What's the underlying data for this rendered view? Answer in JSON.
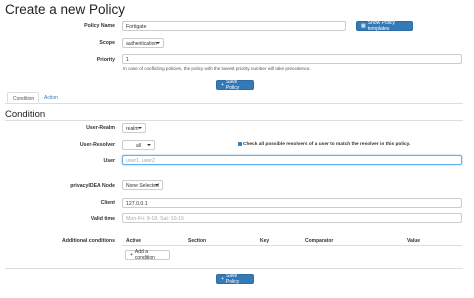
{
  "page": {
    "title": "Create a new Policy"
  },
  "form": {
    "policy_name": {
      "label": "Policy Name",
      "value": "Fortigate"
    },
    "show_templates": "Show Policy templates",
    "scope": {
      "label": "Scope",
      "value": "authentication"
    },
    "priority": {
      "label": "Priority",
      "value": "1",
      "help": "In case of conflicting policies, the policy with the lowest priority number will take precedence."
    },
    "save_top": "Save Policy",
    "save_bottom": "Save Policy"
  },
  "tabs": [
    {
      "label": "Condition"
    },
    {
      "label": "Action"
    }
  ],
  "condition": {
    "heading": "Condition",
    "user_realm": {
      "label": "User-Realm",
      "value": "realm"
    },
    "user_resolver": {
      "label": "User-Resolver",
      "value": "all",
      "check_label": "Check all possible resolvers of a user to match the resolver in this policy."
    },
    "user": {
      "label": "User",
      "placeholder": "user1, user2"
    },
    "privacyidea_node": {
      "label": "privacyIDEA Node",
      "value": "None Selected"
    },
    "client": {
      "label": "Client",
      "value": "127.0.0.1"
    },
    "valid_time": {
      "label": "Valid time",
      "placeholder": "Mon-Fri: 9-18, Sat: 10-15"
    },
    "additional": {
      "label": "Additional conditions",
      "columns": [
        "Active",
        "Section",
        "Key",
        "Comparator",
        "Value"
      ],
      "add_button": "Add a condition"
    }
  }
}
